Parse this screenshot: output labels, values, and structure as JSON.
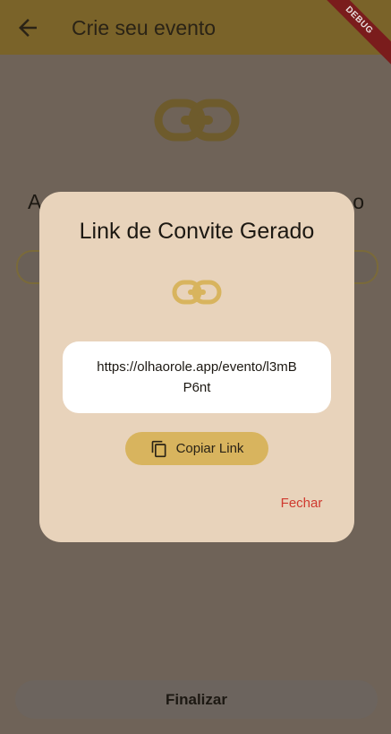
{
  "appbar": {
    "title": "Crie seu evento",
    "debug_label": "DEBUG"
  },
  "page": {
    "heading_left": "A",
    "heading_right": "o",
    "finalize_label": "Finalizar"
  },
  "dialog": {
    "title": "Link de Convite Gerado",
    "link": "https://olhaorole.app/evento/l3mBP6nt",
    "copy_label": "Copiar Link",
    "close_label": "Fechar"
  },
  "colors": {
    "accent": "#d8b45e",
    "dialog_bg": "#e8d3bb",
    "close_text": "#cf3a2f"
  },
  "icons": [
    "back-arrow-icon",
    "link-icon",
    "copy-icon"
  ]
}
